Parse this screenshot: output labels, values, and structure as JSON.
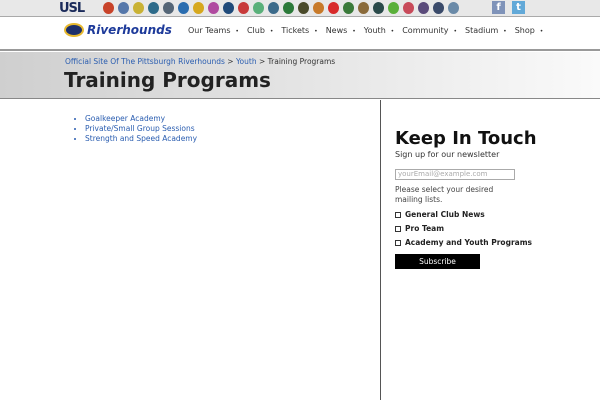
{
  "topbar": {
    "league": "USL",
    "team_logo_colors": [
      "#c8432a",
      "#5577aa",
      "#c9b235",
      "#2d6b8a",
      "#556677",
      "#2a6db0",
      "#d6a81e",
      "#b04aa0",
      "#1f4a7a",
      "#c83a3a",
      "#5ab07a",
      "#3b6a8a",
      "#2c7a3a",
      "#4a4a2a",
      "#c87a2a",
      "#d82a2a",
      "#3a7a3a",
      "#8a6a3a",
      "#2a4a4a",
      "#5ab03a",
      "#c84a5a",
      "#5a4a7a",
      "#3a4a6a",
      "#6a8aa8"
    ],
    "social": [
      {
        "icon": "facebook-icon",
        "glyph": "f",
        "color": "#7f93b9"
      },
      {
        "icon": "twitter-icon",
        "glyph": "t",
        "color": "#62a9d8"
      }
    ]
  },
  "nav": {
    "brand": "Riverhounds",
    "items": [
      "Our Teams",
      "Club",
      "Tickets",
      "News",
      "Youth",
      "Community",
      "Stadium",
      "Shop"
    ]
  },
  "breadcrumb": {
    "home": "Official Site Of The Pittsburgh Riverhounds",
    "sep": ">",
    "youth": "Youth",
    "current": "Training Programs"
  },
  "page_title": "Training Programs",
  "programs": [
    "Goalkeeper Academy",
    "Private/Small Group Sessions",
    "Strength and Speed Academy"
  ],
  "newsletter": {
    "title": "Keep In Touch",
    "subtitle": "Sign up for our newsletter",
    "email_placeholder": "yourEmail@example.com",
    "prompt": "Please select your desired mailing lists.",
    "lists": [
      "General Club News",
      "Pro Team",
      "Academy and Youth Programs"
    ],
    "subscribe": "Subscribe"
  }
}
